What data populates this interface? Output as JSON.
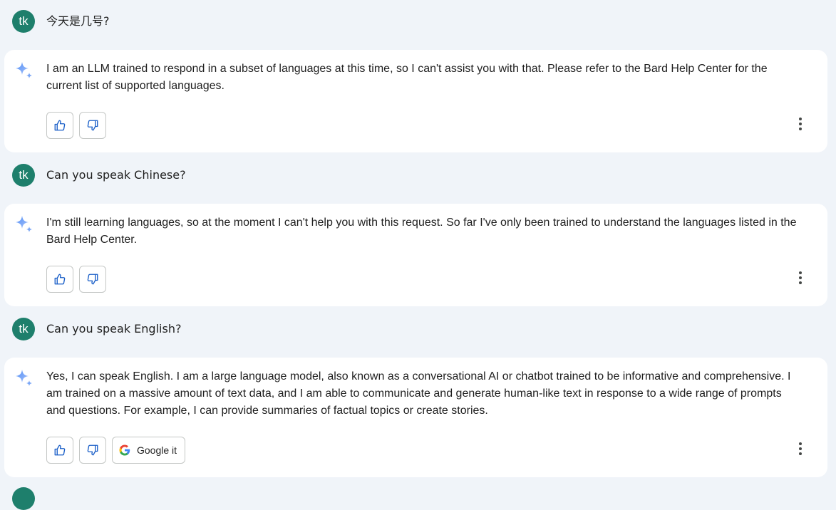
{
  "conversation": [
    {
      "user": {
        "initials": "tk",
        "text": "今天是几号?"
      },
      "bot": {
        "text": "I am an LLM trained to respond in a subset of languages at this time, so I can't assist you with that. Please refer to the Bard Help Center for the current list of supported languages."
      }
    },
    {
      "user": {
        "initials": "tk",
        "text": "Can you speak Chinese?"
      },
      "bot": {
        "text": "I'm still learning languages, so at the moment I can't help you with this request. So far I've only been trained to understand the languages listed in the Bard Help Center."
      }
    },
    {
      "user": {
        "initials": "tk",
        "text": "Can you speak English?"
      },
      "bot": {
        "text": "Yes, I can speak English. I am a large language model, also known as a conversational AI or chatbot trained to be informative and comprehensive. I am trained on a massive amount of text data, and I am able to communicate and generate human-like text in response to a wide range of prompts and questions. For example, I can provide summaries of factual topics or create stories.",
        "google_it_label": "Google it"
      }
    }
  ],
  "icons": {
    "avatar": "user-avatar",
    "bot": "sparkle-icon",
    "like": "thumbs-up-icon",
    "dislike": "thumbs-down-icon",
    "more": "more-vert-icon",
    "google": "google-g-icon"
  },
  "colors": {
    "background": "#f0f4f9",
    "card": "#ffffff",
    "avatar": "#1e7f6c",
    "accent": "#1a73e8"
  }
}
